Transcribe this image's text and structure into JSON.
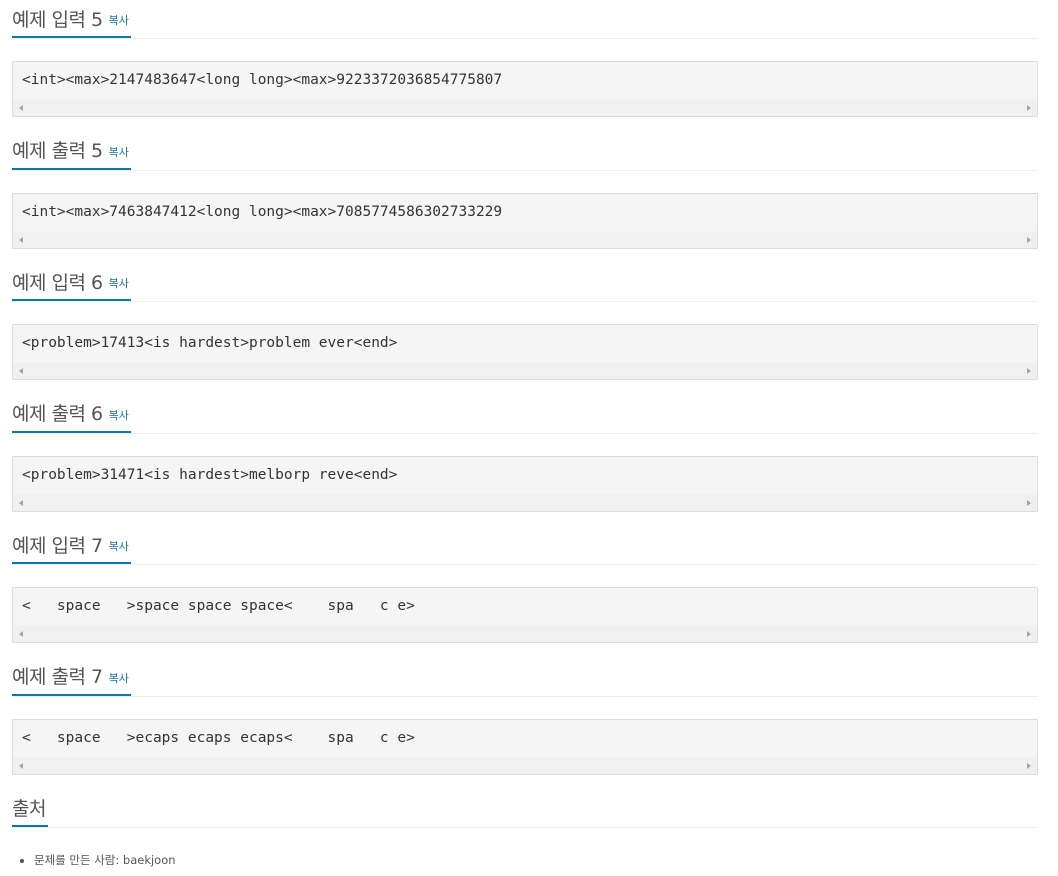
{
  "copy_label": "복사",
  "examples": [
    {
      "title": "예제 입력 5",
      "code": "<int><max>2147483647<long long><max>9223372036854775807"
    },
    {
      "title": "예제 출력 5",
      "code": "<int><max>7463847412<long long><max>7085774586302733229"
    },
    {
      "title": "예제 입력 6",
      "code": "<problem>17413<is hardest>problem ever<end>"
    },
    {
      "title": "예제 출력 6",
      "code": "<problem>31471<is hardest>melborp reve<end>"
    },
    {
      "title": "예제 입력 7",
      "code": "<   space   >space space space<    spa   c e>"
    },
    {
      "title": "예제 출력 7",
      "code": "<   space   >ecaps ecaps ecaps<    spa   c e>"
    }
  ],
  "source": {
    "title": "출처",
    "items": [
      "문제를 만든 사람: baekjoon"
    ]
  }
}
